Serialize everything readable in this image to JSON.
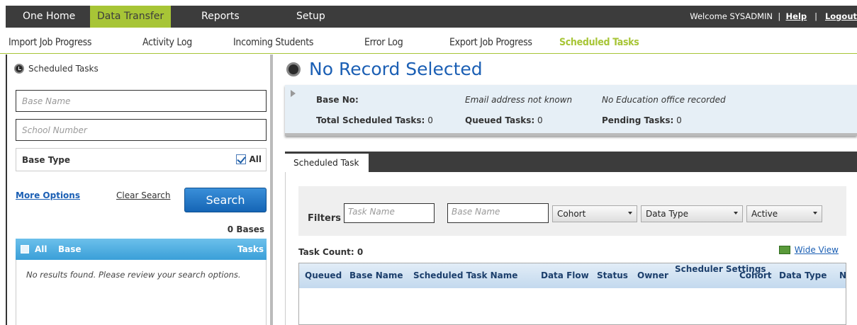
{
  "topnav": {
    "items": [
      "One Home",
      "Data Transfer",
      "Reports",
      "Setup"
    ],
    "welcome": "Welcome  SYSADMIN",
    "help": "Help",
    "logout": "Logout"
  },
  "subnav": {
    "items": [
      "Import Job Progress",
      "Activity Log",
      "Incoming Students",
      "Error Log",
      "Export Job Progress",
      "Scheduled Tasks"
    ]
  },
  "sidebar": {
    "title": "Scheduled Tasks",
    "base_name_placeholder": "Base Name",
    "school_number_placeholder": "School Number",
    "base_type_label": "Base Type",
    "all_label": "All",
    "more_options": "More Options",
    "clear_search": "Clear Search",
    "search": "Search",
    "bases_count": "0 Bases",
    "list_header": {
      "all": "All",
      "base": "Base",
      "tasks": "Tasks"
    },
    "no_results": "No results found. Please review your search options."
  },
  "main": {
    "title": "No Record Selected",
    "info": {
      "base_no_label": "Base No:",
      "email": "Email address not known",
      "education_office": "No Education office recorded",
      "total_label": "Total Scheduled Tasks:",
      "total_value": "0",
      "queued_label": "Queued Tasks:",
      "queued_value": "0",
      "pending_label": "Pending Tasks:",
      "pending_value": "0"
    },
    "tab": "Scheduled Task",
    "filters": {
      "label": "Filters",
      "task_name_placeholder": "Task Name",
      "base_name_placeholder": "Base Name",
      "cohort": "Cohort",
      "data_type": "Data Type",
      "active": "Active"
    },
    "task_count": "Task Count: 0",
    "wide_view": "Wide View",
    "columns": [
      "Queued",
      "Base Name",
      "Scheduled Task Name",
      "Data Flow",
      "Status",
      "Owner",
      "Scheduler Settings",
      "Cohort",
      "Data Type",
      "N"
    ]
  }
}
